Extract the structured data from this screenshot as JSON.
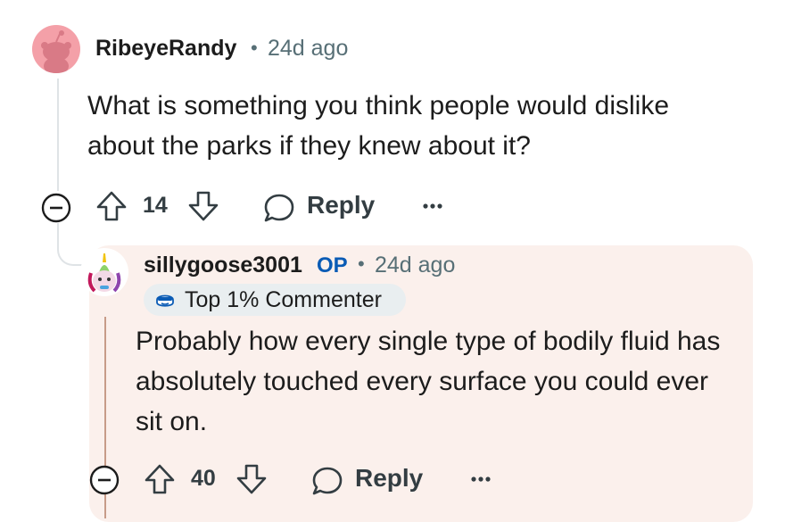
{
  "comment": {
    "username": "RibeyeRandy",
    "time": "24d ago",
    "body_lines": [
      "What is something you think people would dislike",
      "about the parks if they knew about it?"
    ],
    "upvotes": "14",
    "reply_label": "Reply",
    "avatar_icon": "reddit-snoo-icon"
  },
  "reply": {
    "username": "sillygoose3001",
    "op_badge": "OP",
    "time": "24d ago",
    "flair": "Top 1% Commenter",
    "flair_icon": "cool-face-icon",
    "body_lines": [
      "Probably how every single type of bodily fluid has",
      "absolutely touched every surface you could ever",
      "sit on."
    ],
    "upvotes": "40",
    "reply_label": "Reply",
    "avatar_icon": "unicorn-avatar-icon"
  },
  "colors": {
    "op_blue": "#0a5bb5",
    "op_panel": "#fbf0ec",
    "meta_gray": "#576f76",
    "avatar_pink": "#f4a0a8"
  }
}
